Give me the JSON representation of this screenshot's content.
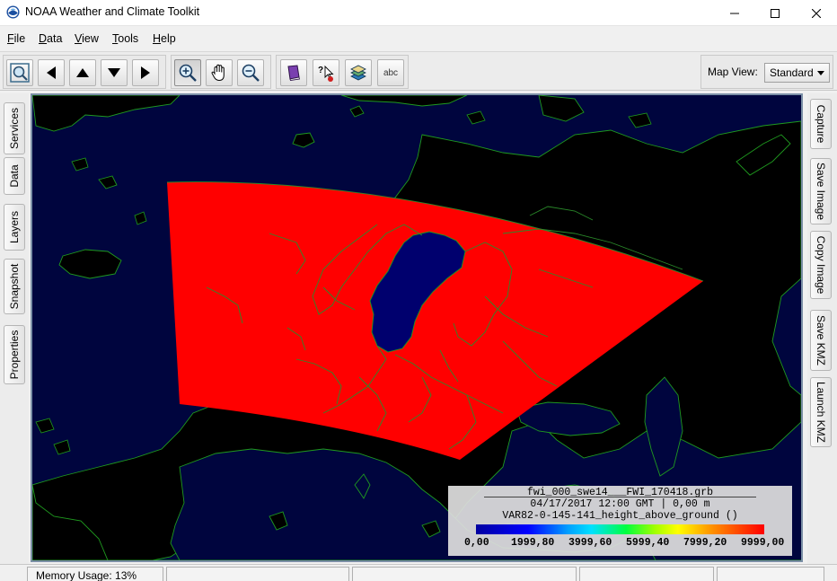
{
  "window": {
    "title": "NOAA Weather and Climate Toolkit"
  },
  "menu": [
    {
      "label": "File",
      "mnemonic": "F",
      "rest": "ile"
    },
    {
      "label": "Data",
      "mnemonic": "D",
      "rest": "ata"
    },
    {
      "label": "View",
      "mnemonic": "V",
      "rest": "iew"
    },
    {
      "label": "Tools",
      "mnemonic": "T",
      "rest": "ools"
    },
    {
      "label": "Help",
      "mnemonic": "H",
      "rest": "elp"
    }
  ],
  "toolbar": {
    "buttons": [
      {
        "icon": "zoom-to-extent-icon",
        "pressed": false
      },
      {
        "icon": "pan-left-icon",
        "pressed": false
      },
      {
        "icon": "pan-up-icon",
        "pressed": false
      },
      {
        "icon": "pan-down-icon",
        "pressed": false
      },
      {
        "icon": "pan-right-icon",
        "pressed": false
      },
      {
        "icon": "zoom-in-icon",
        "pressed": true
      },
      {
        "icon": "hand-pan-icon",
        "pressed": false
      },
      {
        "icon": "zoom-out-icon",
        "pressed": false
      },
      {
        "icon": "bookmark-icon",
        "pressed": false
      },
      {
        "icon": "identify-icon",
        "pressed": false
      },
      {
        "icon": "layers-icon",
        "pressed": false
      },
      {
        "icon": "label-icon",
        "pressed": false,
        "text": "abc"
      }
    ],
    "map_view_label": "Map View:",
    "map_view_value": "Standard"
  },
  "left_tabs": [
    "Services",
    "Data",
    "Layers",
    "Snapshot",
    "Properties"
  ],
  "right_tabs": [
    "Capture",
    "Save Image",
    "Copy Image",
    "Save KMZ",
    "Launch KMZ"
  ],
  "legend": {
    "line1": "fwi_000_swe14___FWI_170418.grb",
    "line2": "04/17/2017 12:00 GMT | 0,00 m",
    "line3": "VAR82-0-145-141_height_above_ground ()",
    "ticks": [
      "0,00",
      "1999,80",
      "3999,60",
      "5999,40",
      "7999,20",
      "9999,00"
    ]
  },
  "colors": {
    "ocean": "#00053e",
    "land": "#000000",
    "data_fill": "#ff0000",
    "data_low": "#00006e",
    "coastline": "#1f9a1f"
  },
  "status": {
    "memory": "Memory Usage: 13%"
  }
}
